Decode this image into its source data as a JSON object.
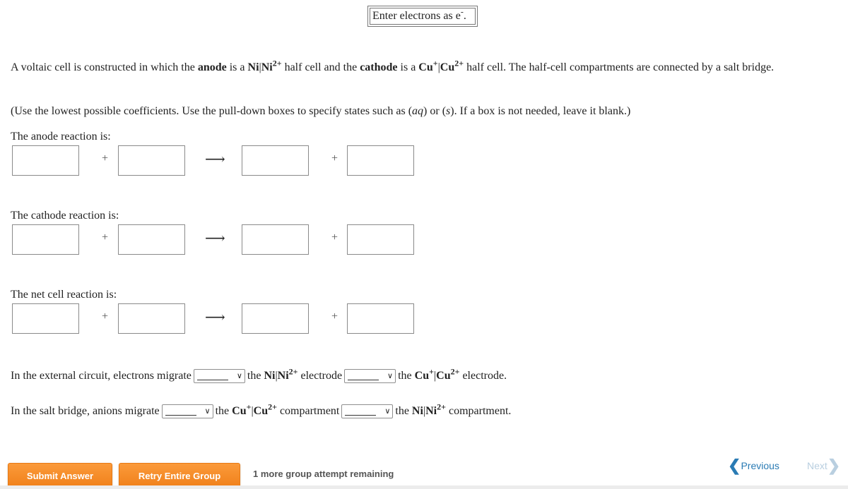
{
  "hint": {
    "text": "Enter electrons as e",
    "superscript": "-",
    "suffix": "."
  },
  "problem": {
    "p1": "A voltaic cell is constructed in which the ",
    "anode_word": "anode",
    "p2": " is a ",
    "anode_cell_a": "Ni",
    "sep": "|",
    "anode_cell_b": "Ni",
    "anode_charge": "2+",
    "p3": " half cell and the ",
    "cathode_word": "cathode",
    "p4": " is a ",
    "cathode_cell_a": "Cu",
    "cathode_charge_a": "+",
    "cathode_cell_b": "Cu",
    "cathode_charge_b": "2+",
    "p5": " half cell. The half-cell compartments are connected by a salt bridge."
  },
  "instructions": {
    "t1": "(Use the lowest possible coefficients. Use the pull-down boxes to specify states such as (",
    "aq": "aq",
    "t2": ") or (",
    "s": "s",
    "t3": "). If a box is not needed, leave it blank.)"
  },
  "reactions": [
    {
      "label": "The anode reaction is:",
      "plus": "+",
      "arrow": "⟶",
      "boxes": [
        "",
        "",
        "",
        ""
      ]
    },
    {
      "label": "The cathode reaction is:",
      "plus": "+",
      "arrow": "⟶",
      "boxes": [
        "",
        "",
        "",
        ""
      ]
    },
    {
      "label": "The net cell reaction is:",
      "plus": "+",
      "arrow": "⟶",
      "boxes": [
        "",
        "",
        "",
        ""
      ]
    }
  ],
  "external_circuit": {
    "lead": "In the external circuit, electrons migrate",
    "mid_the": "the",
    "mid_a": "Ni",
    "mid_b": "Ni",
    "mid_charge": "2+",
    "mid_tail": "electrode",
    "end_the": "the",
    "end_a": "Cu",
    "end_charge_a": "+",
    "end_b": "Cu",
    "end_charge_b": "2+",
    "end_tail": "electrode.",
    "select1_value": "",
    "select2_value": ""
  },
  "salt_bridge": {
    "lead": "In the salt bridge, anions migrate",
    "mid_the": "the",
    "mid_a": "Cu",
    "mid_charge_a": "+",
    "mid_b": "Cu",
    "mid_charge_b": "2+",
    "mid_tail": "compartment",
    "end_the": "the",
    "end_a": "Ni",
    "end_b": "Ni",
    "end_charge": "2+",
    "end_tail": "compartment.",
    "select1_value": "",
    "select2_value": ""
  },
  "sep": "|",
  "footer": {
    "submit_label": "Submit Answer",
    "retry_label": "Retry Entire Group",
    "attempts_text": "1 more group attempt remaining",
    "previous_label": "Previous",
    "next_label": "Next"
  },
  "colors": {
    "button_orange": "#f58a24",
    "link_blue": "#2a7bb4",
    "disabled_blue": "#b9cfe0"
  }
}
